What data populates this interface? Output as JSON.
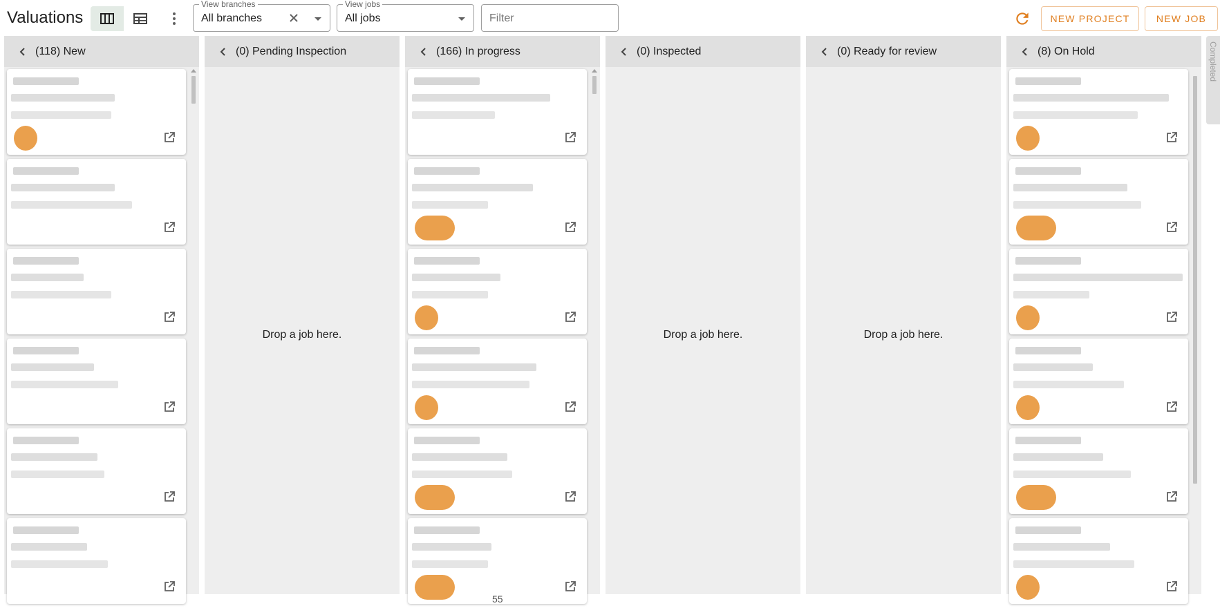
{
  "app": {
    "title": "Valuations"
  },
  "toolbar": {
    "view_branches": {
      "legend": "View branches",
      "value": "All branches"
    },
    "view_jobs": {
      "legend": "View jobs",
      "value": "All jobs"
    },
    "filter": {
      "placeholder": "Filter"
    },
    "new_project": "NEW PROJECT",
    "new_job": "NEW JOB"
  },
  "colors": {
    "accent": "#e07f20",
    "badge": "#e8963a",
    "column_bg": "#eeeeee",
    "header_bg": "#e0e0e0"
  },
  "columns": [
    {
      "label": "(118) New",
      "empty": false
    },
    {
      "label": "(0) Pending Inspection",
      "empty": true,
      "drop_text": "Drop a job here."
    },
    {
      "label": "(166) In progress",
      "empty": false
    },
    {
      "label": "(0) Inspected",
      "empty": true,
      "drop_text": "Drop a job here."
    },
    {
      "label": "(0) Ready for review",
      "empty": true,
      "drop_text": "Drop a job here."
    },
    {
      "label": "(8) On Hold",
      "empty": false
    }
  ],
  "side_panel": {
    "label": "Completed"
  },
  "stray_text": "55"
}
